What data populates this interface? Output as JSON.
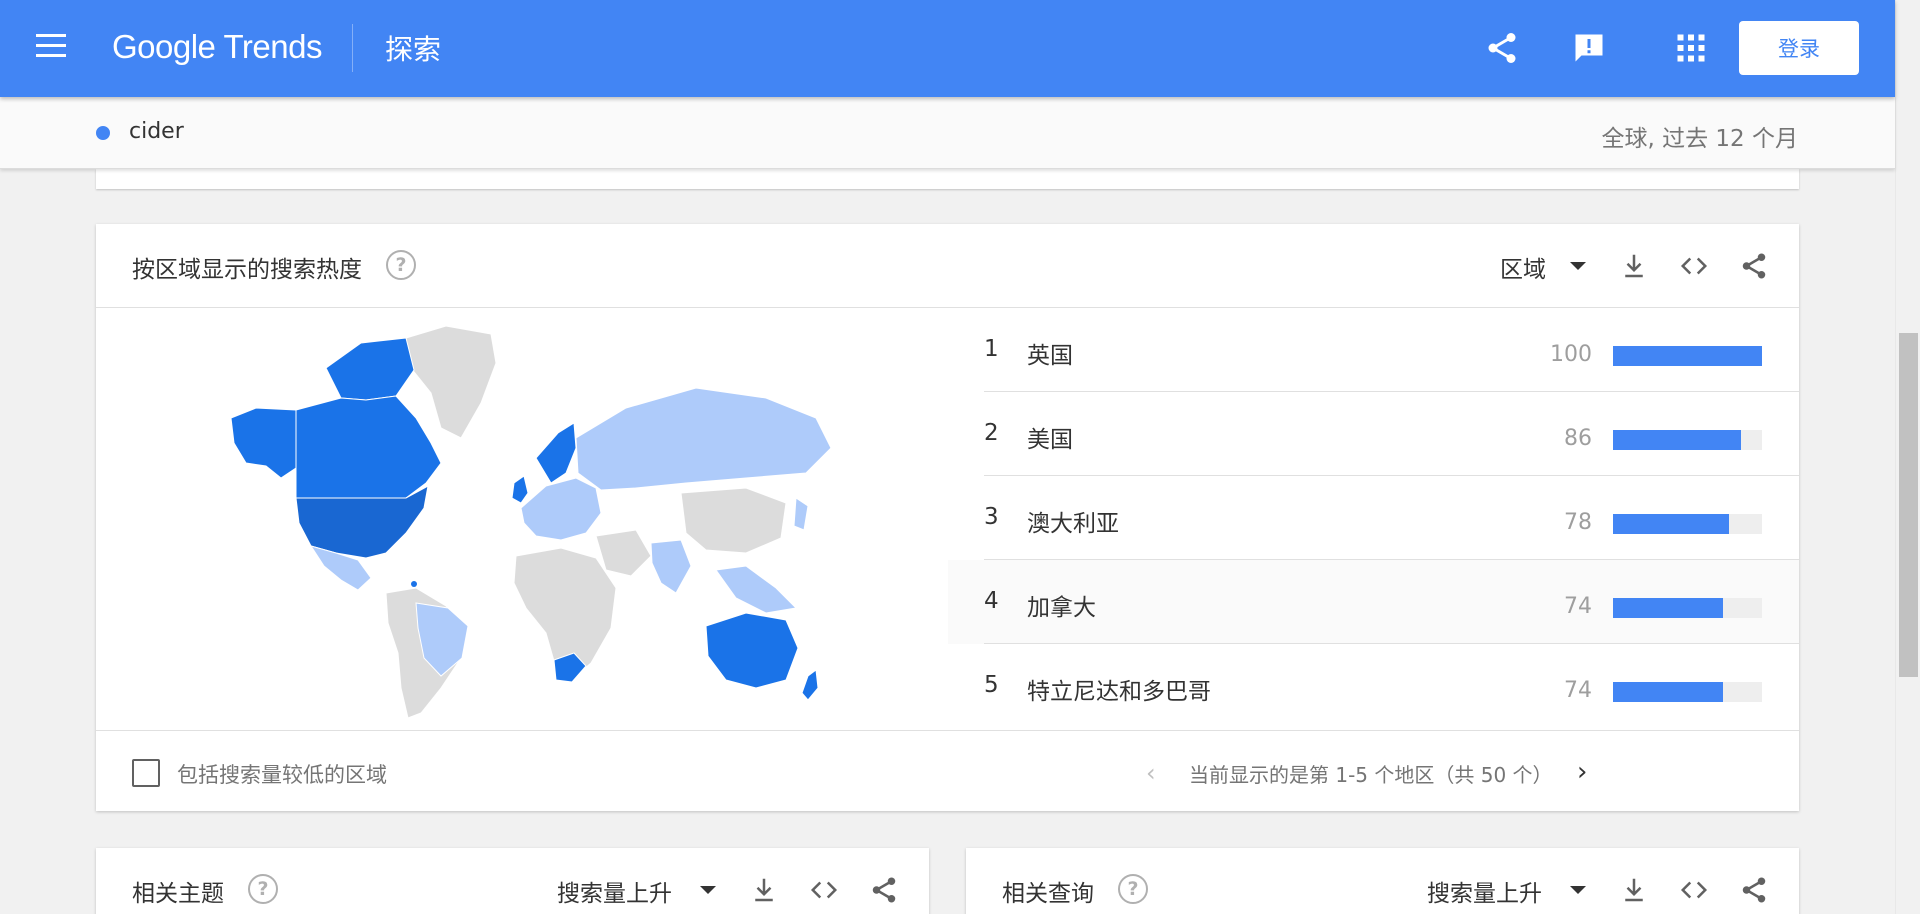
{
  "header": {
    "logo": "Google Trends",
    "page_title": "探索",
    "login_label": "登录",
    "icons": [
      "menu-icon",
      "share-icon",
      "feedback-icon",
      "apps-icon"
    ]
  },
  "term_bar": {
    "term": "cider",
    "term_color": "#4285f4",
    "scope": "全球, 过去 12 个月"
  },
  "region_card": {
    "title": "按区域显示的搜索热度",
    "resolution_select": "区域",
    "rows": [
      {
        "rank": "1",
        "name": "英国",
        "value": "100",
        "pct": 100
      },
      {
        "rank": "2",
        "name": "美国",
        "value": "86",
        "pct": 86
      },
      {
        "rank": "3",
        "name": "澳大利亚",
        "value": "78",
        "pct": 78
      },
      {
        "rank": "4",
        "name": "加拿大",
        "value": "74",
        "pct": 74
      },
      {
        "rank": "5",
        "name": "特立尼达和多巴哥",
        "value": "74",
        "pct": 74
      }
    ],
    "include_low_volume_label": "包括搜索量较低的区域",
    "pager_text": "当前显示的是第 1-5 个地区（共 50 个）"
  },
  "topics_card": {
    "title": "相关主题",
    "sort_select": "搜索量上升"
  },
  "queries_card": {
    "title": "相关查询",
    "sort_select": "搜索量上升"
  },
  "colors": {
    "brand_blue": "#4285f4",
    "map_strong": "#1a73e8",
    "map_light": "#aecbfa",
    "map_none": "#dcdcdc"
  }
}
